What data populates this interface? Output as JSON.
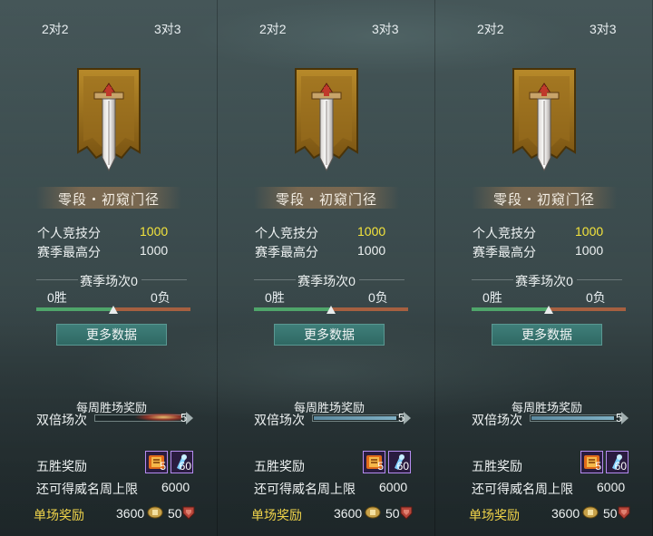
{
  "panels": [
    {
      "tabs": {
        "left": "2对2",
        "right": "3对3"
      },
      "rank_title": "零段・初窥门径",
      "personal_score_label": "个人竞技分",
      "personal_score": "1000",
      "season_best_label": "赛季最高分",
      "season_best": "1000",
      "season_matches": "赛季场次0",
      "wins": "0胜",
      "losses": "0负",
      "win_ratio": 0.5,
      "more_button": "更多数据",
      "weekly_title": "每周胜场奖励",
      "double_label": "双倍场次",
      "double_count": "5",
      "double_fill": 0,
      "five_win_label": "五胜奖励",
      "item1_count": "5",
      "item2_count": "60",
      "weekly_limit_label": "还可得威名周上限",
      "weekly_limit": "6000",
      "single_label": "单场奖励",
      "single_coin": "3600",
      "single_rep": "50"
    },
    {
      "tabs": {
        "left": "2对2",
        "right": "3对3"
      },
      "rank_title": "零段・初窥门径",
      "personal_score_label": "个人竞技分",
      "personal_score": "1000",
      "season_best_label": "赛季最高分",
      "season_best": "1000",
      "season_matches": "赛季场次0",
      "wins": "0胜",
      "losses": "0负",
      "win_ratio": 0.5,
      "more_button": "更多数据",
      "weekly_title": "每周胜场奖励",
      "double_label": "双倍场次",
      "double_count": "5",
      "double_fill": 0.95,
      "five_win_label": "五胜奖励",
      "item1_count": "5",
      "item2_count": "60",
      "weekly_limit_label": "还可得威名周上限",
      "weekly_limit": "6000",
      "single_label": "单场奖励",
      "single_coin": "3600",
      "single_rep": "50"
    },
    {
      "tabs": {
        "left": "2对2",
        "right": "3对3"
      },
      "rank_title": "零段・初窥门径",
      "personal_score_label": "个人竞技分",
      "personal_score": "1000",
      "season_best_label": "赛季最高分",
      "season_best": "1000",
      "season_matches": "赛季场次0",
      "wins": "0胜",
      "losses": "0负",
      "win_ratio": 0.5,
      "more_button": "更多数据",
      "weekly_title": "每周胜场奖励",
      "double_label": "双倍场次",
      "double_count": "5",
      "double_fill": 0.95,
      "five_win_label": "五胜奖励",
      "item1_count": "5",
      "item2_count": "60",
      "weekly_limit_label": "还可得威名周上限",
      "weekly_limit": "6000",
      "single_label": "单场奖励",
      "single_coin": "3600",
      "single_rep": "50"
    }
  ],
  "colors": {
    "score_highlight": "#f4e43c",
    "single_reward_label": "#f0d44a",
    "win_bar": "#4fa56a",
    "loss_bar": "#a66040",
    "button": "#2f6863"
  }
}
